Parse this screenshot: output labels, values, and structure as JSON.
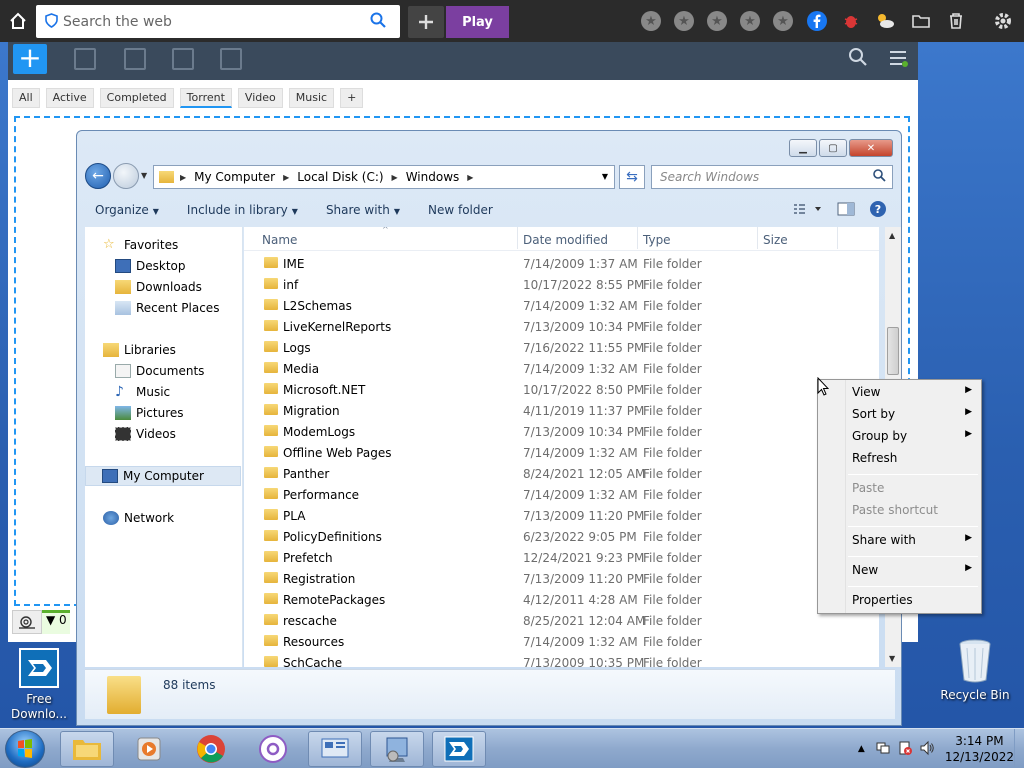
{
  "browser": {
    "search_placeholder": "Search the web",
    "play_label": "Play"
  },
  "downloader": {
    "tabs": [
      "All",
      "Active",
      "Completed",
      "Torrent",
      "Video",
      "Music"
    ],
    "add_tab": "+",
    "filter_label": "▼ 0"
  },
  "desktop": {
    "icons": [
      {
        "label": "Free Downlo..."
      },
      {
        "label": "Recycle Bin"
      }
    ]
  },
  "explorer": {
    "breadcrumb": [
      "My Computer",
      "Local Disk (C:)",
      "Windows"
    ],
    "search_placeholder": "Search Windows",
    "commands": [
      "Organize",
      "Include in library",
      "Share with",
      "New folder"
    ],
    "nav": {
      "favorites": "Favorites",
      "desktop": "Desktop",
      "downloads": "Downloads",
      "recent": "Recent Places",
      "libraries": "Libraries",
      "documents": "Documents",
      "music": "Music",
      "pictures": "Pictures",
      "videos": "Videos",
      "mycomputer": "My Computer",
      "network": "Network"
    },
    "columns": {
      "name": "Name",
      "date": "Date modified",
      "type": "Type",
      "size": "Size"
    },
    "files": [
      {
        "name": "IME",
        "date": "7/14/2009 1:37 AM",
        "type": "File folder"
      },
      {
        "name": "inf",
        "date": "10/17/2022 8:55 PM",
        "type": "File folder"
      },
      {
        "name": "L2Schemas",
        "date": "7/14/2009 1:32 AM",
        "type": "File folder"
      },
      {
        "name": "LiveKernelReports",
        "date": "7/13/2009 10:34 PM",
        "type": "File folder"
      },
      {
        "name": "Logs",
        "date": "7/16/2022 11:55 PM",
        "type": "File folder"
      },
      {
        "name": "Media",
        "date": "7/14/2009 1:32 AM",
        "type": "File folder"
      },
      {
        "name": "Microsoft.NET",
        "date": "10/17/2022 8:50 PM",
        "type": "File folder"
      },
      {
        "name": "Migration",
        "date": "4/11/2019 11:37 PM",
        "type": "File folder"
      },
      {
        "name": "ModemLogs",
        "date": "7/13/2009 10:34 PM",
        "type": "File folder"
      },
      {
        "name": "Offline Web Pages",
        "date": "7/14/2009 1:32 AM",
        "type": "File folder"
      },
      {
        "name": "Panther",
        "date": "8/24/2021 12:05 AM",
        "type": "File folder"
      },
      {
        "name": "Performance",
        "date": "7/14/2009 1:32 AM",
        "type": "File folder"
      },
      {
        "name": "PLA",
        "date": "7/13/2009 11:20 PM",
        "type": "File folder"
      },
      {
        "name": "PolicyDefinitions",
        "date": "6/23/2022 9:05 PM",
        "type": "File folder"
      },
      {
        "name": "Prefetch",
        "date": "12/24/2021 9:23 PM",
        "type": "File folder"
      },
      {
        "name": "Registration",
        "date": "7/13/2009 11:20 PM",
        "type": "File folder"
      },
      {
        "name": "RemotePackages",
        "date": "4/12/2011 4:28 AM",
        "type": "File folder"
      },
      {
        "name": "rescache",
        "date": "8/25/2021 12:04 AM",
        "type": "File folder"
      },
      {
        "name": "Resources",
        "date": "7/14/2009 1:32 AM",
        "type": "File folder"
      },
      {
        "name": "SchCache",
        "date": "7/13/2009 10:35 PM",
        "type": "File folder"
      }
    ],
    "item_count": "88 items"
  },
  "context_menu": {
    "view": "View",
    "sort_by": "Sort by",
    "group_by": "Group by",
    "refresh": "Refresh",
    "paste": "Paste",
    "paste_shortcut": "Paste shortcut",
    "share_with": "Share with",
    "new": "New",
    "properties": "Properties"
  },
  "taskbar": {
    "time": "3:14 PM",
    "date": "12/13/2022"
  },
  "colors": {
    "play": "#7b3fa0",
    "accent": "#2196f3",
    "close": "#c4442c"
  }
}
